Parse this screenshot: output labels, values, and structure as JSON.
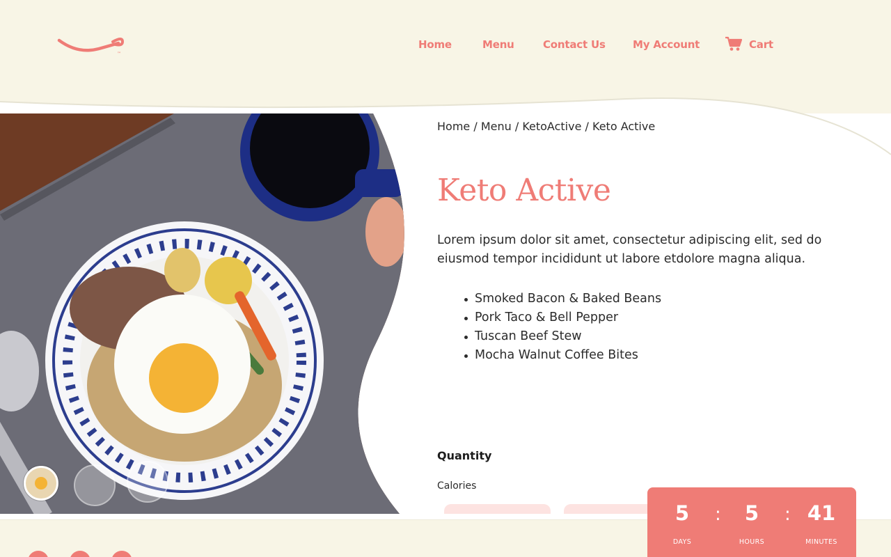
{
  "colors": {
    "accent": "#ef7c76",
    "header_bg": "#f8f5e6",
    "text": "#2b2b2b",
    "countdown_bg": "#ef7c76"
  },
  "brand": {
    "trademark": "™"
  },
  "nav": {
    "home": "Home",
    "menu": "Menu",
    "contact": "Contact Us",
    "account": "My Account",
    "cart": "Cart",
    "cart_icon": "cart-icon"
  },
  "breadcrumb": {
    "home": "Home",
    "menu": "Menu",
    "category": "KetoActive",
    "current": "Keto Active",
    "separator": "/"
  },
  "product": {
    "title": "Keto Active",
    "description": "Lorem ipsum dolor sit amet, consectetur adipiscing elit, sed do eiusmod tempor incididunt ut labore etdolore magna aliqua.",
    "dishes": [
      "Smoked Bacon & Baked Beans",
      "Pork Taco & Bell Pepper",
      "Tuscan Beef Stew",
      "Mocha Walnut Coffee Bites"
    ],
    "quantity_label": "Quantity",
    "calories_label": "Calories"
  },
  "gallery": {
    "thumbnail_count": 3,
    "active_index": 0
  },
  "countdown": {
    "days": "5",
    "hours": "5",
    "minutes": "41",
    "separator": ":",
    "days_label": "DAYS",
    "hours_label": "HOURS",
    "minutes_label": "MINUTES"
  }
}
